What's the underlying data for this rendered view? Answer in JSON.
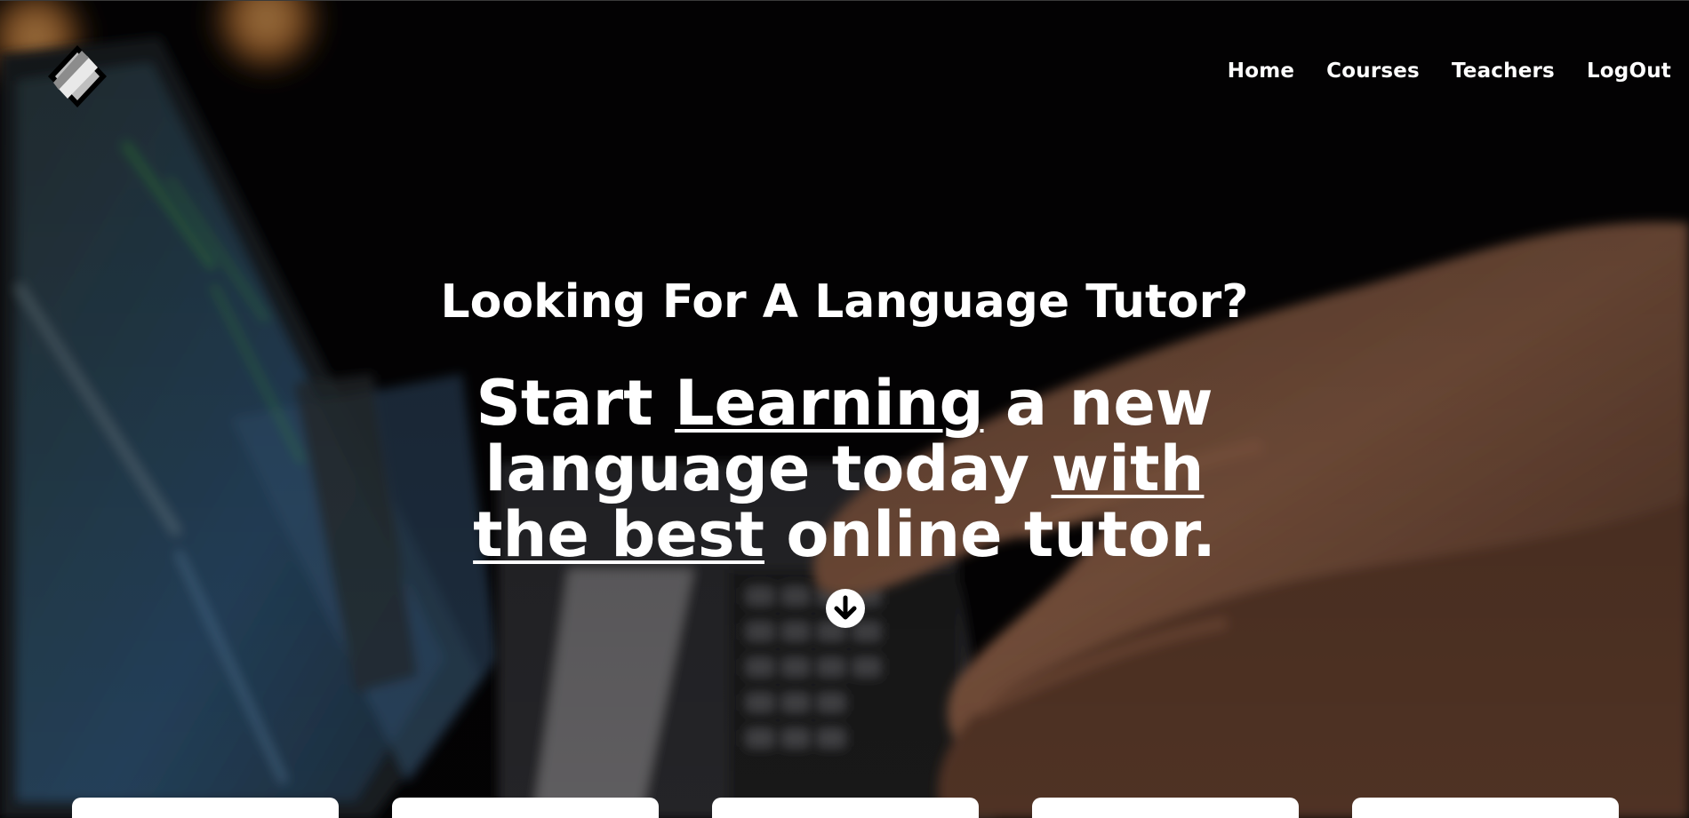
{
  "header": {
    "logo_icon": "diamond-logo-icon",
    "nav": [
      {
        "label": "Home"
      },
      {
        "label": "Courses"
      },
      {
        "label": "Teachers"
      },
      {
        "label": "LogOut"
      }
    ]
  },
  "hero": {
    "eyebrow": "Looking For A Language Tutor?",
    "headline": {
      "part1": "Start ",
      "part2_underlined": "Learning",
      "part3": " a new language today ",
      "part4_underlined": "with the best",
      "part5": " online tutor."
    },
    "scroll_icon": "arrow-down-circle-icon"
  },
  "cards": [
    {},
    {},
    {},
    {},
    {}
  ],
  "colors": {
    "text": "#ffffff",
    "background": "#000000",
    "card": "#ffffff"
  }
}
